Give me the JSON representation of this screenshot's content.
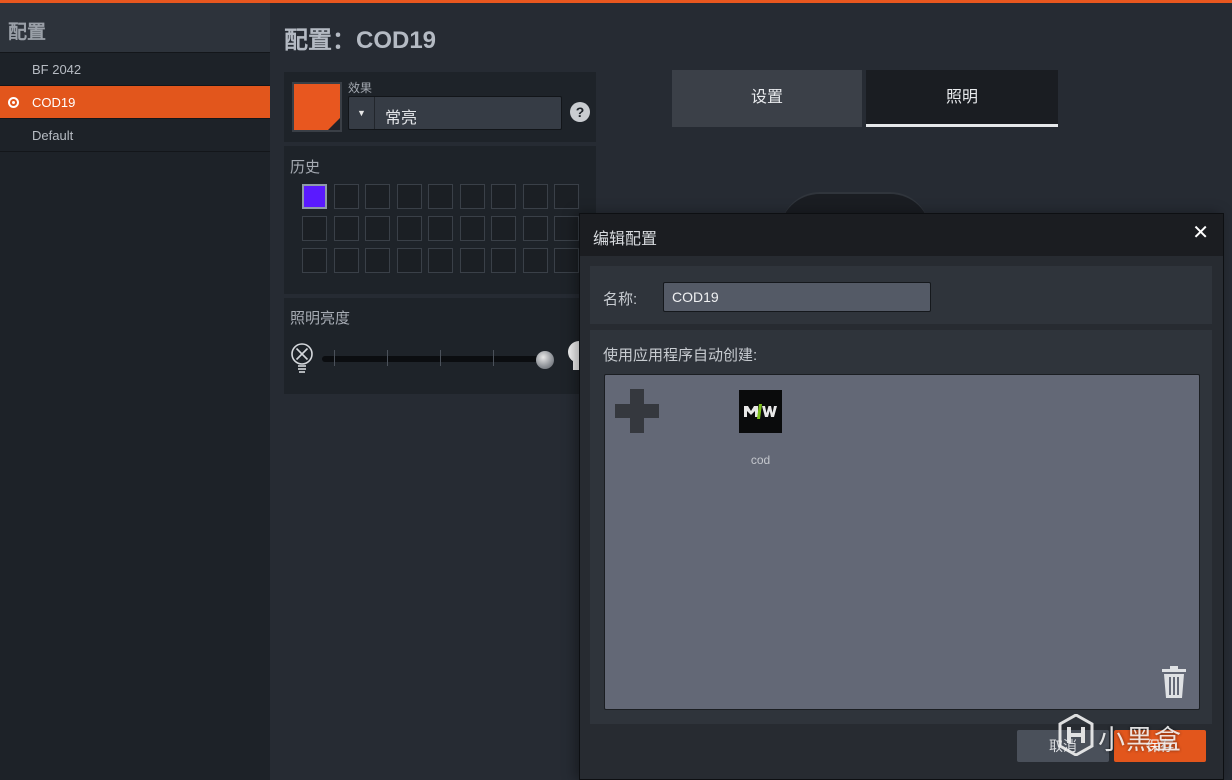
{
  "sidebar": {
    "title": "配置",
    "profiles": [
      {
        "label": "BF 2042",
        "active": false
      },
      {
        "label": "COD19",
        "active": true
      },
      {
        "label": "Default",
        "active": false
      }
    ]
  },
  "main": {
    "page_title": "配置：COD19",
    "effect": {
      "label": "效果",
      "value": "常亮",
      "swatch_color": "#e8571f"
    },
    "history": {
      "label": "历史",
      "first_color": "#5a1aff"
    },
    "brightness": {
      "label": "照明亮度",
      "level": 1.0
    },
    "tabs": [
      {
        "label": "设置",
        "active": false
      },
      {
        "label": "照明",
        "active": true
      }
    ]
  },
  "dialog": {
    "title": "编辑配置",
    "close": "✕",
    "name_label": "名称:",
    "name_value": "COD19",
    "auto_label": "使用应用程序自动创建:",
    "apps": [
      {
        "name": "cod",
        "icon": "mw-logo-icon"
      }
    ],
    "cancel_label": "取消",
    "save_label": "保存"
  },
  "watermark": {
    "text": "小黑盒"
  },
  "colors": {
    "accent": "#e2561c",
    "background": "#262b33"
  }
}
